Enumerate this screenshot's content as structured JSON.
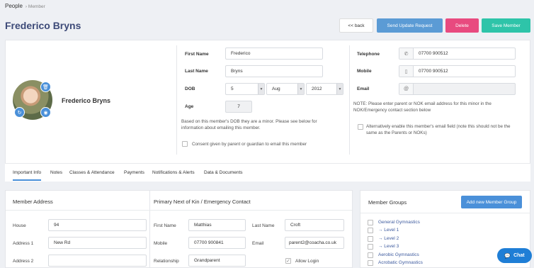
{
  "breadcrumb": {
    "root": "People",
    "current": "Member"
  },
  "header": {
    "title": "Frederico Bryns"
  },
  "actions": {
    "back": "<< back",
    "send_update": "Send Update Request",
    "delete": "Delete",
    "save": "Save Member"
  },
  "profile": {
    "name": "Frederico Bryns"
  },
  "details": {
    "first_name_label": "First Name",
    "first_name": "Frederico",
    "last_name_label": "Last Name",
    "last_name": "Bryns",
    "dob_label": "DOB",
    "dob_day": "5",
    "dob_month": "Aug",
    "dob_year": "2012",
    "age_label": "Age",
    "age": "7",
    "minor_note": "Based on this member's DOB they are a minor. Please see below for information about emailing this member.",
    "consent_label": "Consent given by parent or guardian to email this member"
  },
  "contact": {
    "telephone_label": "Telephone",
    "telephone": "07700 900512",
    "mobile_label": "Mobile",
    "mobile": "07700 900512",
    "email_label": "Email",
    "email_addon": "@",
    "email": "",
    "email_note": "NOTE: Please enter parent or NOK email address for this minor in the NOK/Emergency contact section below",
    "alt_email_label": "Alternatively enable this member's email field (note this should not be the same as the Parents or NOKs)"
  },
  "tabs": [
    "Important Info",
    "Notes",
    "Classes & Attendance",
    "Payments",
    "Notifications & Alerts",
    "Data & Documents"
  ],
  "address": {
    "title": "Member Address",
    "house_label": "House",
    "house": "94",
    "address1_label": "Address 1",
    "address1": "New Rd",
    "address2_label": "Address 2",
    "address2": ""
  },
  "nok": {
    "title": "Primary Next of Kin / Emergency Contact",
    "first_name_label": "First Name",
    "first_name": "Matthias",
    "last_name_label": "Last Name",
    "last_name": "Croft",
    "mobile_label": "Mobile",
    "mobile": "07700 900841",
    "email_label": "Email",
    "email": "parent2@coacha.co.uk",
    "relationship_label": "Relationship",
    "relationship": "Grandparent",
    "allow_login_label": "Allow Login"
  },
  "groups": {
    "title": "Member Groups",
    "add_button": "Add new Member Group",
    "items": [
      "General Gymnastics",
      "→ Level 1",
      "→ Level 2",
      "→ Level 3",
      "Aerobic Gymnastics",
      "Acrobatic Gymnastics"
    ]
  },
  "chat": {
    "label": "Chat"
  },
  "colors": {
    "primary": "#4a90d9",
    "danger": "#e84a7f",
    "success": "#2ec4a9",
    "title": "#3d4a78"
  }
}
